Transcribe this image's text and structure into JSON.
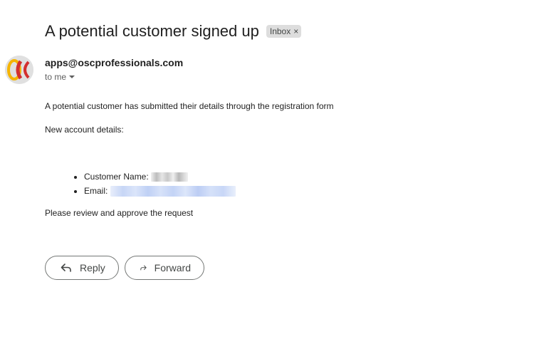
{
  "email": {
    "subject": "A potential customer signed up",
    "label": "Inbox",
    "label_remove_glyph": "×",
    "sender": "apps@oscprofessionals.com",
    "recipient": "to me",
    "avatar_icon": "osc-logo-icon",
    "body": {
      "intro": "A potential customer has submitted their details through the registration form",
      "details_heading": "New account details:",
      "details": [
        {
          "label": "Customer Name:",
          "value_redacted": true
        },
        {
          "label": "Email:",
          "value_redacted": true
        }
      ],
      "closing": "Please review and approve the request"
    }
  },
  "actions": {
    "reply_label": "Reply",
    "reply_icon": "reply-icon",
    "forward_label": "Forward",
    "forward_icon": "forward-icon"
  },
  "colors": {
    "logo_red": "#d32f2f",
    "logo_yellow": "#f5b400",
    "logo_bg": "#e0e0e0"
  }
}
